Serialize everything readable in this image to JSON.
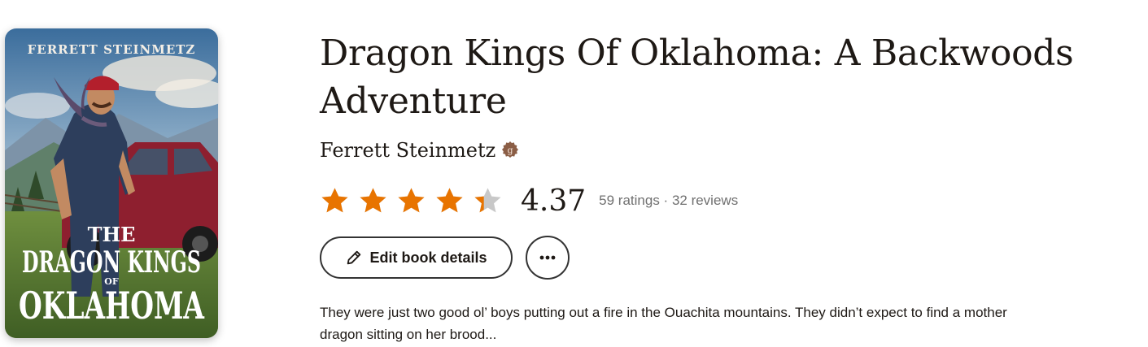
{
  "book": {
    "title": "Dragon Kings Of Oklahoma: A Backwoods Adventure",
    "author": "Ferrett Steinmetz",
    "author_badge_icon": "goodreads-author-icon",
    "rating": {
      "average": "4.37",
      "average_value": 4.37,
      "stars_max": 5,
      "ratings_text": "59 ratings",
      "separator": " · ",
      "reviews_text": "32 reviews"
    },
    "actions": {
      "edit_label": "Edit book details",
      "edit_icon": "pencil-icon",
      "more_icon": "more-horizontal-icon"
    },
    "description": "They were just two good ol’ boys putting out a fire in the Ouachita mountains. They didn’t expect to find a mother dragon sitting on her brood..."
  },
  "cover": {
    "author": "FERRETT STEINMETZ",
    "title_line1": "THE",
    "title_line2": "DRAGON KINGS",
    "title_line3": "OF",
    "title_line4": "OKLAHOMA"
  },
  "colors": {
    "star_filled": "#e87400",
    "star_empty": "#c8c8c8",
    "text": "#1e1915",
    "muted": "#707070",
    "badge": "#8b5e46"
  }
}
